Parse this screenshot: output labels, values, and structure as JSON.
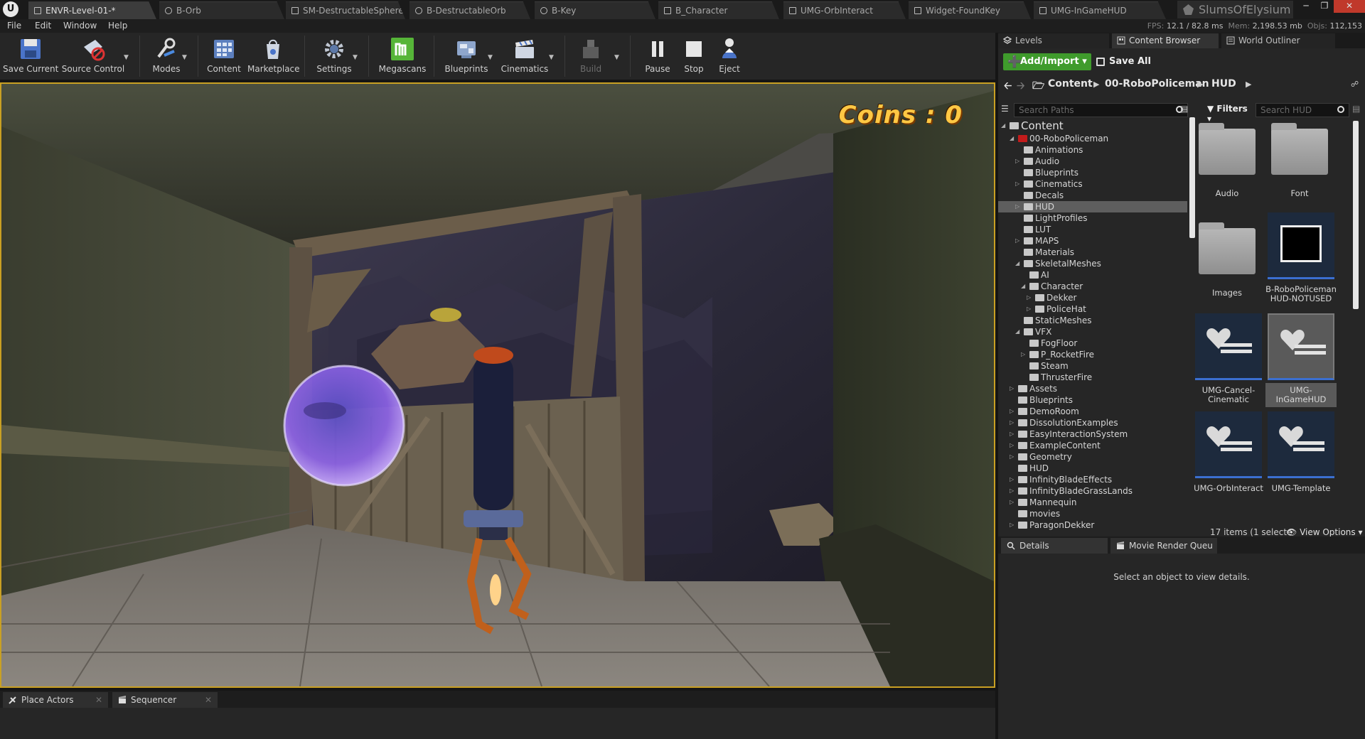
{
  "tabs": [
    {
      "label": "ENVR-Level-01-*",
      "active": true
    },
    {
      "label": "B-Orb"
    },
    {
      "label": "SM-DestructableSphere"
    },
    {
      "label": "B-DestructableOrb"
    },
    {
      "label": "B-Key"
    },
    {
      "label": "B_Character"
    },
    {
      "label": "UMG-OrbInteract"
    },
    {
      "label": "Widget-FoundKey"
    },
    {
      "label": "UMG-InGameHUD"
    }
  ],
  "project_name": "SlumsOfElysium",
  "menu": [
    "File",
    "Edit",
    "Window",
    "Help"
  ],
  "stats": {
    "fps_label": "FPS:",
    "fps": "12.1",
    "ms": "/ 82.8 ms",
    "mem_label": "Mem:",
    "mem": "2,198.53 mb",
    "objs_label": "Objs:",
    "objs": "112,153"
  },
  "toolbar": {
    "save_current": "Save Current",
    "source_control": "Source Control",
    "modes": "Modes",
    "content": "Content",
    "marketplace": "Marketplace",
    "settings": "Settings",
    "megascans": "Megascans",
    "blueprints": "Blueprints",
    "cinematics": "Cinematics",
    "build": "Build",
    "pause": "Pause",
    "stop": "Stop",
    "eject": "Eject"
  },
  "viewport": {
    "hud_text": "Coins : 0"
  },
  "bottom_tabs": [
    "Place Actors",
    "Sequencer"
  ],
  "right_tabs": [
    "Levels",
    "Content Browser",
    "World Outliner"
  ],
  "content_browser": {
    "add_import": "Add/Import",
    "save_all": "Save All",
    "breadcrumb": [
      "Content",
      "00-RoboPoliceman",
      "HUD"
    ],
    "search_paths_placeholder": "Search Paths",
    "filters": "Filters",
    "search_hud_placeholder": "Search HUD",
    "tree": [
      {
        "label": "Content",
        "depth": 0,
        "expanded": true,
        "root": true
      },
      {
        "label": "00-RoboPoliceman",
        "depth": 1,
        "expanded": true,
        "red": true
      },
      {
        "label": "Animations",
        "depth": 2
      },
      {
        "label": "Audio",
        "depth": 2,
        "collapsed": true
      },
      {
        "label": "Blueprints",
        "depth": 2
      },
      {
        "label": "Cinematics",
        "depth": 2,
        "collapsed": true
      },
      {
        "label": "Decals",
        "depth": 2
      },
      {
        "label": "HUD",
        "depth": 2,
        "collapsed": true,
        "selected": true
      },
      {
        "label": "LightProfiles",
        "depth": 2
      },
      {
        "label": "LUT",
        "depth": 2
      },
      {
        "label": "MAPS",
        "depth": 2,
        "collapsed": true
      },
      {
        "label": "Materials",
        "depth": 2
      },
      {
        "label": "SkeletalMeshes",
        "depth": 2,
        "expanded": true
      },
      {
        "label": "AI",
        "depth": 3
      },
      {
        "label": "Character",
        "depth": 3,
        "expanded": true
      },
      {
        "label": "Dekker",
        "depth": 4,
        "collapsed": true
      },
      {
        "label": "PoliceHat",
        "depth": 4,
        "collapsed": true
      },
      {
        "label": "StaticMeshes",
        "depth": 2
      },
      {
        "label": "VFX",
        "depth": 2,
        "expanded": true
      },
      {
        "label": "FogFloor",
        "depth": 3
      },
      {
        "label": "P_RocketFire",
        "depth": 3,
        "collapsed": true
      },
      {
        "label": "Steam",
        "depth": 3
      },
      {
        "label": "ThrusterFire",
        "depth": 3
      },
      {
        "label": "Assets",
        "depth": 1,
        "collapsed": true
      },
      {
        "label": "Blueprints",
        "depth": 1
      },
      {
        "label": "DemoRoom",
        "depth": 1,
        "collapsed": true
      },
      {
        "label": "DissolutionExamples",
        "depth": 1,
        "collapsed": true
      },
      {
        "label": "EasyInteractionSystem",
        "depth": 1,
        "collapsed": true
      },
      {
        "label": "ExampleContent",
        "depth": 1,
        "collapsed": true
      },
      {
        "label": "Geometry",
        "depth": 1,
        "collapsed": true
      },
      {
        "label": "HUD",
        "depth": 1
      },
      {
        "label": "InfinityBladeEffects",
        "depth": 1,
        "collapsed": true
      },
      {
        "label": "InfinityBladeGrassLands",
        "depth": 1,
        "collapsed": true
      },
      {
        "label": "Mannequin",
        "depth": 1,
        "collapsed": true
      },
      {
        "label": "movies",
        "depth": 1
      },
      {
        "label": "ParagonDekker",
        "depth": 1,
        "collapsed": true
      }
    ],
    "assets": [
      {
        "label": "Audio",
        "kind": "folder"
      },
      {
        "label": "Font",
        "kind": "folder"
      },
      {
        "label": "Images",
        "kind": "folder"
      },
      {
        "label": "B-RoboPoliceman HUD-NOTUSED",
        "kind": "widget"
      },
      {
        "label": "UMG-Cancel-Cinematic",
        "kind": "umg"
      },
      {
        "label": "UMG-InGameHUD",
        "kind": "umg",
        "selected": true
      },
      {
        "label": "UMG-OrbInteract",
        "kind": "umg"
      },
      {
        "label": "UMG-Template",
        "kind": "umg"
      }
    ],
    "items_count": "17 items (1 selecte",
    "view_options": "View Options"
  },
  "details": {
    "tabs": [
      "Details",
      "Movie Render Queu"
    ],
    "empty_message": "Select an object to view details."
  },
  "colors": {
    "accent_gold": "#ffc844",
    "viewport_border": "#c9a023",
    "add_green": "#3f9b2c",
    "selection_blue": "#3b6fd1"
  }
}
